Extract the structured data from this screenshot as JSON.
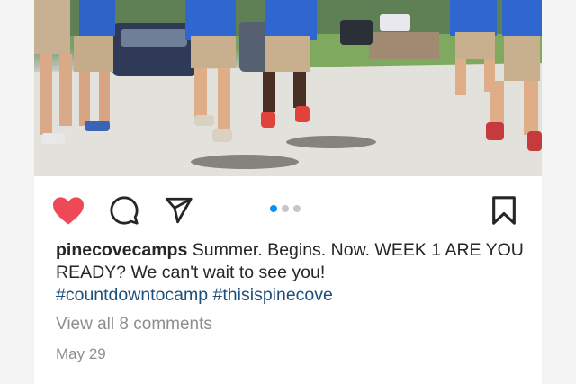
{
  "post": {
    "username": "pinecovecamps",
    "caption": "Summer. Begins. Now. WEEK 1 ARE YOU READY? We can't wait to see you!",
    "hashtags": [
      "#countdowntocamp",
      "#thisispinecove"
    ],
    "comments_link": "View all 8 comments",
    "date": "May 29",
    "liked": true,
    "carousel": {
      "total": 3,
      "active": 1
    }
  },
  "icons": {
    "like": "heart-icon",
    "comment": "comment-icon",
    "share": "send-icon",
    "save": "bookmark-icon"
  },
  "colors": {
    "heart": "#ed4956",
    "active_dot": "#0095f6",
    "hashtag": "#1e4f7a",
    "muted": "#8e8e8e"
  }
}
